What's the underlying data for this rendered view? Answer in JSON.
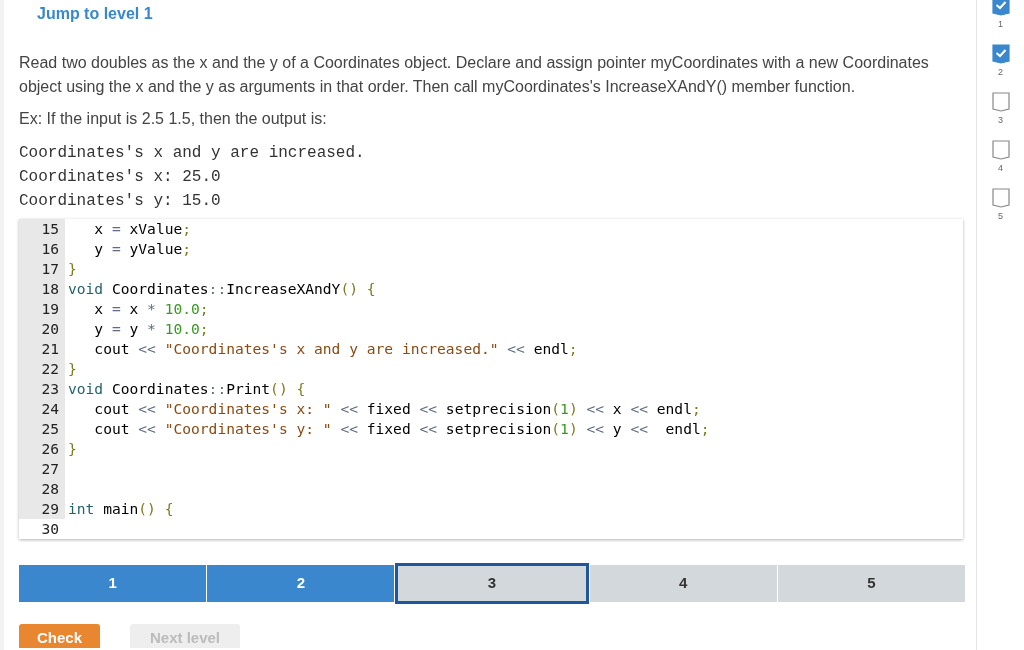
{
  "jump_link": "Jump to level 1",
  "instructions": "Read two doubles as the x and the y of a Coordinates object. Declare and assign pointer myCoordinates with a new Coordinates object using the x and the y as arguments in that order. Then call myCoordinates's IncreaseXAndY() member function.",
  "example_intro": "Ex: If the input is 2.5 1.5, then the output is:",
  "example_output": [
    "Coordinates's x and y are increased.",
    "Coordinates's x: 25.0",
    "Coordinates's y: 15.0"
  ],
  "code_lines": [
    {
      "number": "15",
      "active": false,
      "tokens": [
        {
          "kind": "plain",
          "text": "   x "
        },
        {
          "kind": "op",
          "text": "="
        },
        {
          "kind": "plain",
          "text": " xValue"
        },
        {
          "kind": "punct",
          "text": ";"
        }
      ]
    },
    {
      "number": "16",
      "active": false,
      "tokens": [
        {
          "kind": "plain",
          "text": "   y "
        },
        {
          "kind": "op",
          "text": "="
        },
        {
          "kind": "plain",
          "text": " yValue"
        },
        {
          "kind": "punct",
          "text": ";"
        }
      ]
    },
    {
      "number": "17",
      "active": false,
      "tokens": [
        {
          "kind": "punct",
          "text": "}"
        }
      ]
    },
    {
      "number": "18",
      "active": false,
      "tokens": [
        {
          "kind": "kw",
          "text": "void"
        },
        {
          "kind": "plain",
          "text": " Coordinates"
        },
        {
          "kind": "op",
          "text": "::"
        },
        {
          "kind": "plain",
          "text": "IncreaseXAndY"
        },
        {
          "kind": "punct",
          "text": "() {"
        }
      ]
    },
    {
      "number": "19",
      "active": false,
      "tokens": [
        {
          "kind": "plain",
          "text": "   x "
        },
        {
          "kind": "op",
          "text": "="
        },
        {
          "kind": "plain",
          "text": " x "
        },
        {
          "kind": "op",
          "text": "*"
        },
        {
          "kind": "num",
          "text": " 10.0"
        },
        {
          "kind": "punct",
          "text": ";"
        }
      ]
    },
    {
      "number": "20",
      "active": false,
      "tokens": [
        {
          "kind": "plain",
          "text": "   y "
        },
        {
          "kind": "op",
          "text": "="
        },
        {
          "kind": "plain",
          "text": " y "
        },
        {
          "kind": "op",
          "text": "*"
        },
        {
          "kind": "num",
          "text": " 10.0"
        },
        {
          "kind": "punct",
          "text": ";"
        }
      ]
    },
    {
      "number": "21",
      "active": false,
      "tokens": [
        {
          "kind": "plain",
          "text": "   cout "
        },
        {
          "kind": "op",
          "text": "<<"
        },
        {
          "kind": "str",
          "text": " \"Coordinates's x and y are increased.\""
        },
        {
          "kind": "op",
          "text": " <<"
        },
        {
          "kind": "plain",
          "text": " endl"
        },
        {
          "kind": "punct",
          "text": ";"
        }
      ]
    },
    {
      "number": "22",
      "active": false,
      "tokens": [
        {
          "kind": "punct",
          "text": "}"
        }
      ]
    },
    {
      "number": "23",
      "active": false,
      "tokens": [
        {
          "kind": "kw",
          "text": "void"
        },
        {
          "kind": "plain",
          "text": " Coordinates"
        },
        {
          "kind": "op",
          "text": "::"
        },
        {
          "kind": "plain",
          "text": "Print"
        },
        {
          "kind": "punct",
          "text": "() {"
        }
      ]
    },
    {
      "number": "24",
      "active": false,
      "tokens": [
        {
          "kind": "plain",
          "text": "   cout "
        },
        {
          "kind": "op",
          "text": "<<"
        },
        {
          "kind": "str",
          "text": " \"Coordinates's x: \""
        },
        {
          "kind": "op",
          "text": " <<"
        },
        {
          "kind": "plain",
          "text": " fixed "
        },
        {
          "kind": "op",
          "text": "<<"
        },
        {
          "kind": "plain",
          "text": " setprecision"
        },
        {
          "kind": "punct",
          "text": "("
        },
        {
          "kind": "num",
          "text": "1"
        },
        {
          "kind": "punct",
          "text": ")"
        },
        {
          "kind": "op",
          "text": " <<"
        },
        {
          "kind": "plain",
          "text": " x "
        },
        {
          "kind": "op",
          "text": "<<"
        },
        {
          "kind": "plain",
          "text": " endl"
        },
        {
          "kind": "punct",
          "text": ";"
        }
      ]
    },
    {
      "number": "25",
      "active": false,
      "tokens": [
        {
          "kind": "plain",
          "text": "   cout "
        },
        {
          "kind": "op",
          "text": "<<"
        },
        {
          "kind": "str",
          "text": " \"Coordinates's y: \""
        },
        {
          "kind": "op",
          "text": " <<"
        },
        {
          "kind": "plain",
          "text": " fixed "
        },
        {
          "kind": "op",
          "text": "<<"
        },
        {
          "kind": "plain",
          "text": " setprecision"
        },
        {
          "kind": "punct",
          "text": "("
        },
        {
          "kind": "num",
          "text": "1"
        },
        {
          "kind": "punct",
          "text": ")"
        },
        {
          "kind": "op",
          "text": " <<"
        },
        {
          "kind": "plain",
          "text": " y "
        },
        {
          "kind": "op",
          "text": "<<"
        },
        {
          "kind": "plain",
          "text": "  endl"
        },
        {
          "kind": "punct",
          "text": ";"
        }
      ]
    },
    {
      "number": "26",
      "active": false,
      "tokens": [
        {
          "kind": "punct",
          "text": "}"
        }
      ]
    },
    {
      "number": "27",
      "active": false
    },
    {
      "number": "28",
      "active": false
    },
    {
      "number": "29",
      "active": false,
      "tokens": [
        {
          "kind": "kw",
          "text": "int"
        },
        {
          "kind": "plain",
          "text": " main"
        },
        {
          "kind": "punct",
          "text": "() {"
        }
      ]
    },
    {
      "number": "30",
      "active": true
    }
  ],
  "level_bar": [
    {
      "label": "1",
      "completed": true,
      "selected": false
    },
    {
      "label": "2",
      "completed": true,
      "selected": false
    },
    {
      "label": "3",
      "completed": false,
      "selected": true
    },
    {
      "label": "4",
      "completed": false,
      "selected": false
    },
    {
      "label": "5",
      "completed": false,
      "selected": false
    }
  ],
  "buttons": [
    {
      "label": "Check",
      "disabled": false
    },
    {
      "label": "Next level",
      "disabled": true
    }
  ],
  "level_checklist": [
    {
      "label": "1",
      "checked": true
    },
    {
      "label": "2",
      "checked": true
    },
    {
      "label": "3",
      "checked": false
    },
    {
      "label": "4",
      "checked": false
    },
    {
      "label": "5",
      "checked": false
    }
  ]
}
